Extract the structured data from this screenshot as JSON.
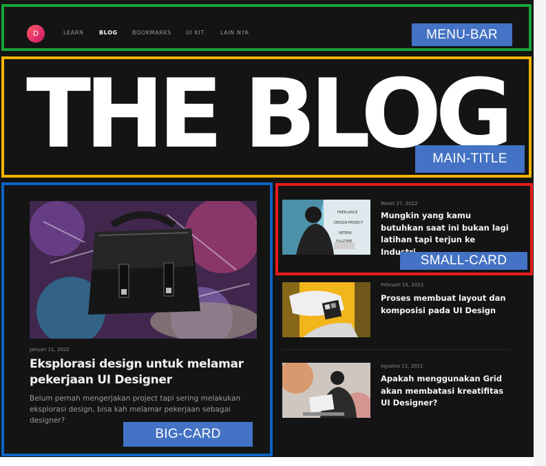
{
  "menu": {
    "logo_letter": "D",
    "items": [
      "LEARN",
      "BLOG",
      "BOOKMARKS",
      "UI KIT",
      "LAIN NYA"
    ],
    "active": "BLOG"
  },
  "hero": {
    "title": "THE BLOG"
  },
  "big_card": {
    "date": "Januari 11, 2022",
    "title": "Eksplorasi design untuk melamar pekerjaan UI Designer",
    "description": "Belum pernah mengerjakan project tapi sering melakukan eksplorasi design, bisa kah melamar pekerjaan sebagai designer?"
  },
  "small_cards": [
    {
      "date": "Maret 27, 2022",
      "title": "Mungkin yang kamu butuhkan saat ini bukan lagi latihan tapi terjun ke Industri"
    },
    {
      "date": "Februari 15, 2022",
      "title": "Proses membuat layout dan komposisi pada UI Design"
    },
    {
      "date": "Agustus 11, 2021",
      "title": "Apakah menggunakan Grid akan membatasi kreatifitas UI Designer?"
    }
  ],
  "annotations": {
    "menu_bar": "MENU-BAR",
    "main_title": "MAIN-TITLE",
    "big_card": "BIG-CARD",
    "small_card": "SMALL-CARD"
  },
  "colors": {
    "background": "#141414",
    "menu_bar_box": "#1aa33a",
    "main_title_box": "#f5b400",
    "big_card_box": "#0b63c4",
    "small_card_box": "#e81c1c",
    "label_fill": "#4472c4"
  }
}
